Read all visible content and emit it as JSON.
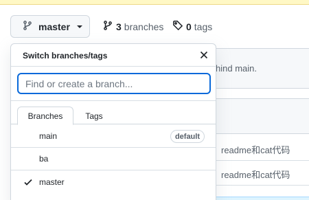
{
  "branch_button": {
    "label": "master",
    "icon": "git-branch-icon"
  },
  "branches_link": {
    "count": "3",
    "label": "branches",
    "icon": "git-branch-icon"
  },
  "tags_link": {
    "count": "0",
    "label": "tags",
    "icon": "tag-icon"
  },
  "background": {
    "ahead_text": "hind main.",
    "commit_rows": [
      {
        "message": "readme和cat代码"
      },
      {
        "message": "readme和cat代码"
      }
    ]
  },
  "dropdown": {
    "title": "Switch branches/tags",
    "close_icon": "close-icon",
    "search_placeholder": "Find or create a branch...",
    "search_value": "",
    "tabs": [
      {
        "label": "Branches",
        "active": true
      },
      {
        "label": "Tags",
        "active": false
      }
    ],
    "items": [
      {
        "label": "main",
        "badge": "default",
        "selected": false
      },
      {
        "label": "ba",
        "badge": "",
        "selected": false
      },
      {
        "label": "master",
        "badge": "",
        "selected": true
      }
    ]
  },
  "colors": {
    "accent": "#0969da",
    "border": "#d0d7de",
    "muted_text": "#57606a",
    "flash": "#fff8c5"
  }
}
